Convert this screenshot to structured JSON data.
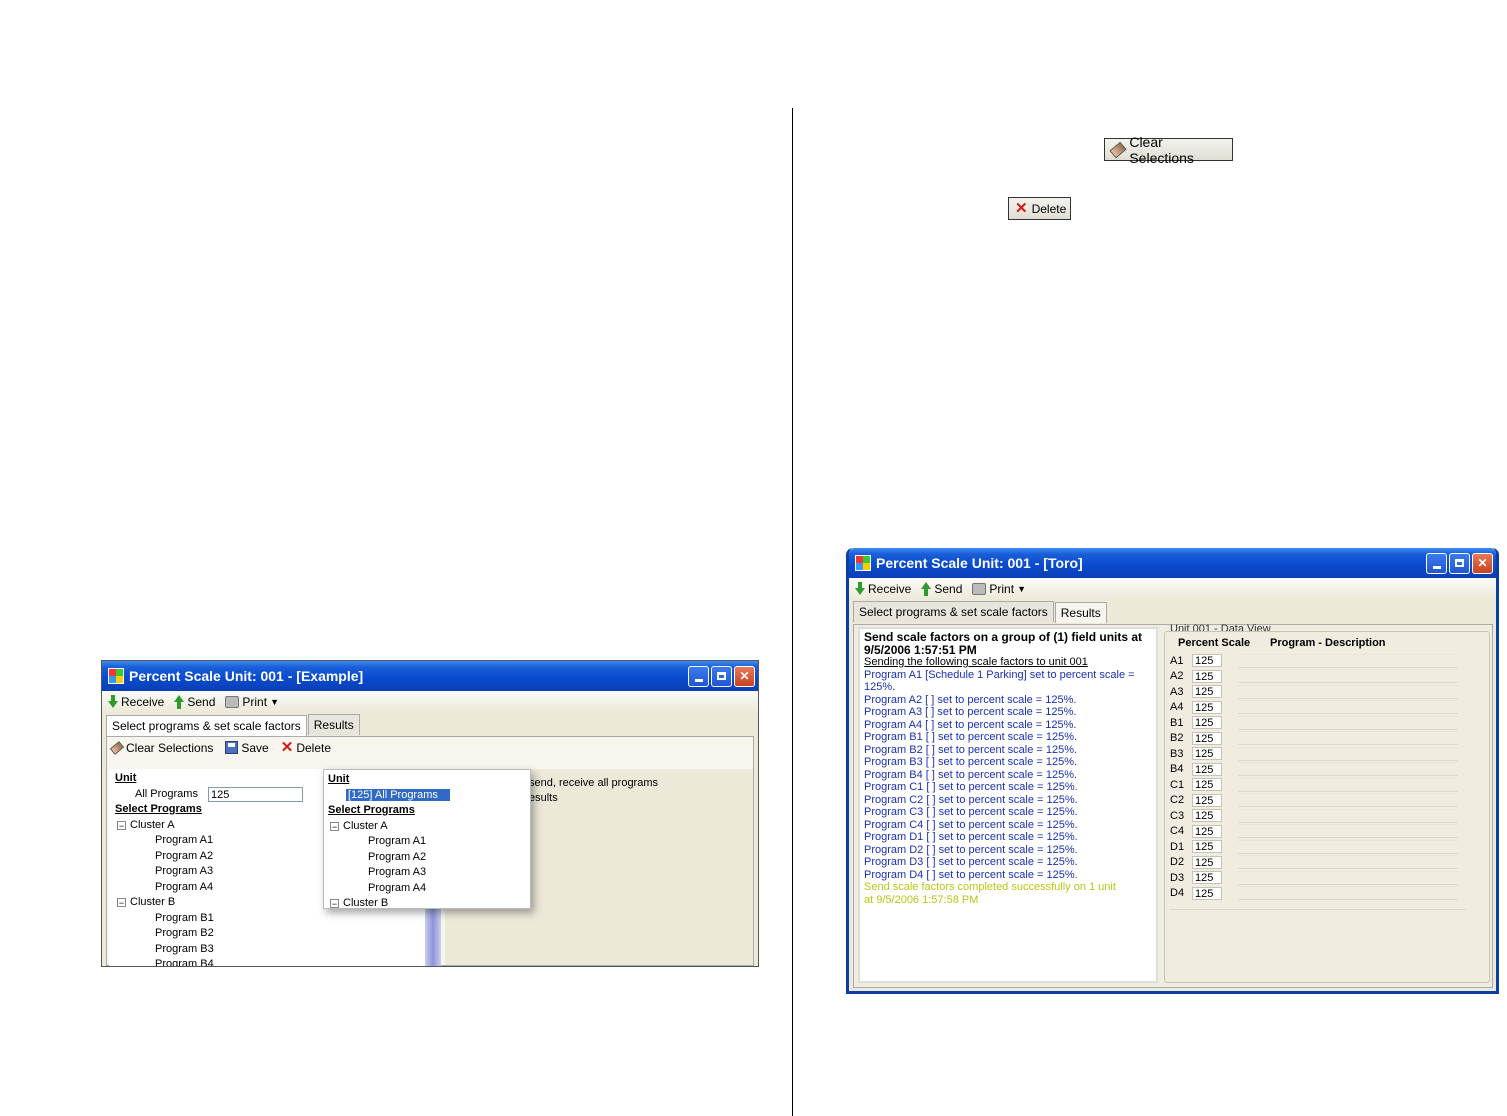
{
  "buttons": {
    "clear_selections": "Clear Selections",
    "delete": "Delete"
  },
  "window1": {
    "title": "Percent Scale Unit: 001 - [Example]",
    "toolbar": {
      "receive": "Receive",
      "send": "Send",
      "print": "Print"
    },
    "tabs": [
      "Select programs & set scale factors",
      "Results"
    ],
    "subtoolbar": {
      "clear": "Clear Selections",
      "save": "Save",
      "delete": "Delete"
    },
    "unit_header": "Unit",
    "all_programs_label": "All Programs",
    "all_programs_value": "125",
    "select_programs_header": "Select Programs",
    "tree": [
      {
        "cluster": "Cluster A",
        "programs": [
          "Program A1",
          "Program A2",
          "Program A3",
          "Program A4"
        ]
      },
      {
        "cluster": "Cluster B",
        "programs": [
          "Program B1",
          "Program B2",
          "Program B3",
          "Program B4"
        ]
      }
    ],
    "info_text": [
      "send, receive all programs",
      "esults"
    ],
    "popup": {
      "unit_header": "Unit",
      "selected_item": "[125] All Programs",
      "select_programs_header": "Select Programs",
      "cluster_a": "Cluster A",
      "programs": [
        "Program A1",
        "Program A2",
        "Program A3",
        "Program A4"
      ],
      "cluster_b": "Cluster B"
    }
  },
  "window2": {
    "title": "Percent Scale Unit: 001 - [Toro]",
    "toolbar": {
      "receive": "Receive",
      "send": "Send",
      "print": "Print"
    },
    "tabs": [
      "Select programs & set scale factors",
      "Results"
    ],
    "results": {
      "heading1": "Send scale factors on a group of (1) field units at",
      "heading2": "9/5/2006 1:57:51 PM",
      "sub": "Sending the following scale factors to unit 001",
      "lines": [
        "Program A1 [Schedule 1 Parking] set to percent scale = 125%.",
        "Program A2 [ ] set to percent scale = 125%.",
        "Program A3 [ ] set to percent scale = 125%.",
        "Program A4 [ ] set to percent scale = 125%.",
        "Program B1 [ ] set to percent scale = 125%.",
        "Program B2 [ ] set to percent scale = 125%.",
        "Program B3 [ ] set to percent scale = 125%.",
        "Program B4 [ ] set to percent scale = 125%.",
        "Program C1 [ ] set to percent scale = 125%.",
        "Program C2 [ ] set to percent scale = 125%.",
        "Program C3 [ ] set to percent scale = 125%.",
        "Program C4 [ ] set to percent scale = 125%.",
        "Program D1 [ ] set to percent scale = 125%.",
        "Program D2 [ ] set to percent scale = 125%.",
        "Program D3 [ ] set to percent scale = 125%.",
        "Program D4 [ ] set to percent scale = 125%."
      ],
      "done1": "Send scale factors completed successfully on 1 unit",
      "done2": "at 9/5/2006 1:57:58 PM"
    },
    "data_view": {
      "title": "Unit 001 - Data View",
      "col_percent": "Percent Scale",
      "col_program": "Program - Description",
      "rows": [
        {
          "label": "A1",
          "value": "125"
        },
        {
          "label": "A2",
          "value": "125"
        },
        {
          "label": "A3",
          "value": "125"
        },
        {
          "label": "A4",
          "value": "125"
        },
        {
          "label": "B1",
          "value": "125"
        },
        {
          "label": "B2",
          "value": "125"
        },
        {
          "label": "B3",
          "value": "125"
        },
        {
          "label": "B4",
          "value": "125"
        },
        {
          "label": "C1",
          "value": "125"
        },
        {
          "label": "C2",
          "value": "125"
        },
        {
          "label": "C3",
          "value": "125"
        },
        {
          "label": "C4",
          "value": "125"
        },
        {
          "label": "D1",
          "value": "125"
        },
        {
          "label": "D2",
          "value": "125"
        },
        {
          "label": "D3",
          "value": "125"
        },
        {
          "label": "D4",
          "value": "125"
        }
      ]
    }
  }
}
